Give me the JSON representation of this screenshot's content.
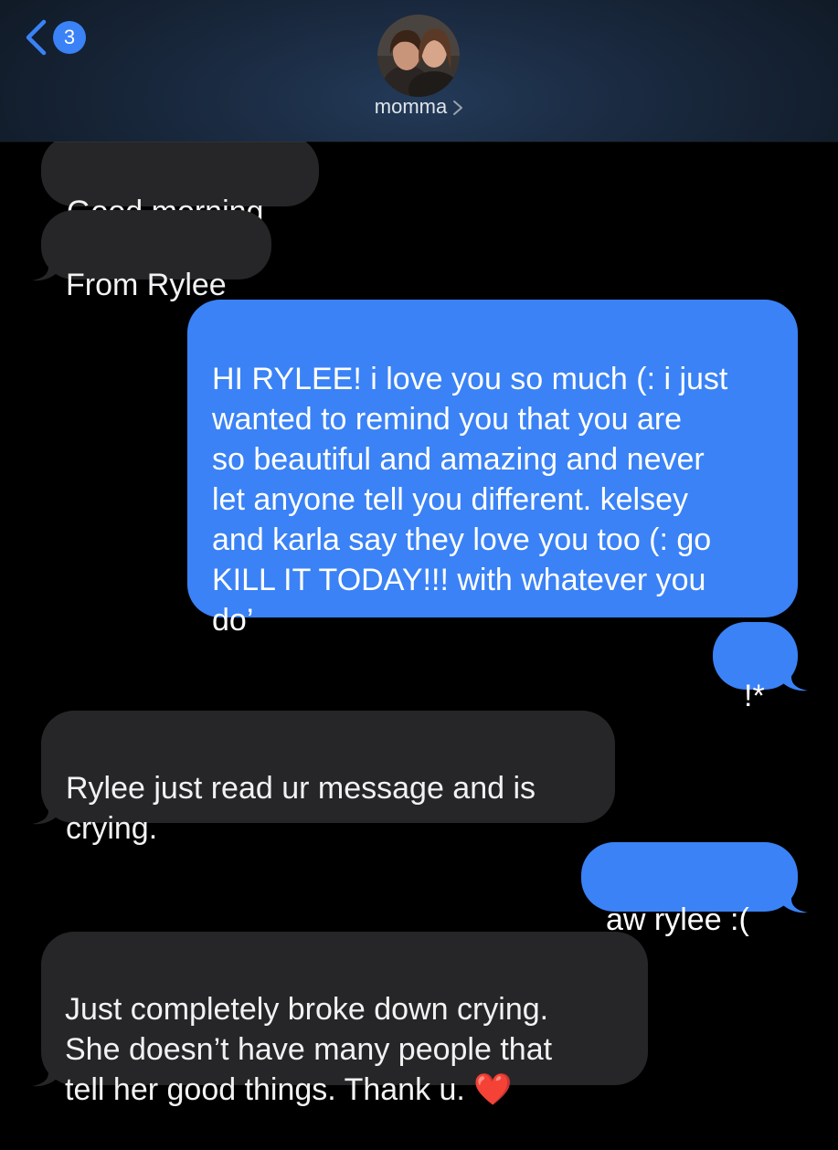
{
  "header": {
    "back_badge_count": "3",
    "contact_name": "momma",
    "back_icon": "chevron-left-icon",
    "name_chevron_icon": "chevron-right-icon"
  },
  "messages": [
    {
      "direction": "incoming",
      "text": "Good morning"
    },
    {
      "direction": "incoming",
      "text": "From Rylee"
    },
    {
      "direction": "outgoing",
      "text": "HI RYLEE! i love you so much (: i just\nwanted to remind you that you are\nso beautiful and amazing and never\nlet anyone tell you different. kelsey\nand karla say they love you too (: go\nKILL IT TODAY!!! with whatever you\ndo’"
    },
    {
      "direction": "outgoing",
      "text": "!*"
    },
    {
      "direction": "incoming",
      "text": "Rylee just read ur message and is\ncrying."
    },
    {
      "direction": "outgoing",
      "text": "aw rylee :("
    },
    {
      "direction": "incoming",
      "text": "Just completely broke down crying.\nShe doesn’t have many people that\ntell her good things. Thank u.",
      "emoji": "❤️"
    }
  ],
  "colors": {
    "incoming_bubble": "#262628",
    "outgoing_bubble": "#3a82f6",
    "background": "#000000",
    "accent": "#3a82f6"
  }
}
